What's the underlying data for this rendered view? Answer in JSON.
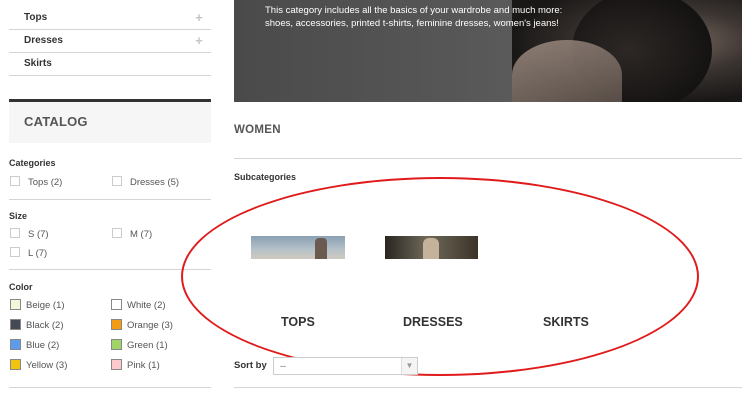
{
  "sidebar": {
    "categories": [
      {
        "label": "Tops",
        "expandable": true
      },
      {
        "label": "Dresses",
        "expandable": true
      },
      {
        "label": "Skirts",
        "expandable": false
      }
    ],
    "plus_glyph": "+",
    "catalog_title": "CATALOG",
    "filters": {
      "categories": {
        "title": "Categories",
        "options": [
          "Tops (2)",
          "Dresses (5)"
        ]
      },
      "size": {
        "title": "Size",
        "options": [
          "S (7)",
          "M (7)",
          "L (7)"
        ]
      },
      "color": {
        "title": "Color",
        "options": [
          {
            "label": "Beige (1)",
            "swatch": "#f5f5dc"
          },
          {
            "label": "White (2)",
            "swatch": "#ffffff"
          },
          {
            "label": "Black (2)",
            "swatch": "#434a54"
          },
          {
            "label": "Orange (3)",
            "swatch": "#f39c11"
          },
          {
            "label": "Blue (2)",
            "swatch": "#5d9cec"
          },
          {
            "label": "Green (1)",
            "swatch": "#a0d468"
          },
          {
            "label": "Yellow (3)",
            "swatch": "#f1c40f"
          },
          {
            "label": "Pink (1)",
            "swatch": "#fccacd"
          }
        ]
      }
    }
  },
  "banner": {
    "lines": [
      "This category includes all the basics of your wardrobe and much more:",
      "shoes, accessories, printed t-shirts, feminine dresses, women's jeans!"
    ]
  },
  "main": {
    "heading": "WOMEN",
    "subcategories_label": "Subcategories",
    "subcategories": [
      "TOPS",
      "DRESSES",
      "SKIRTS"
    ],
    "sort_label": "Sort by",
    "sort_value": "--",
    "select_arrow": "▼"
  },
  "annotation": {
    "ellipse_color": "#e01b1b"
  }
}
